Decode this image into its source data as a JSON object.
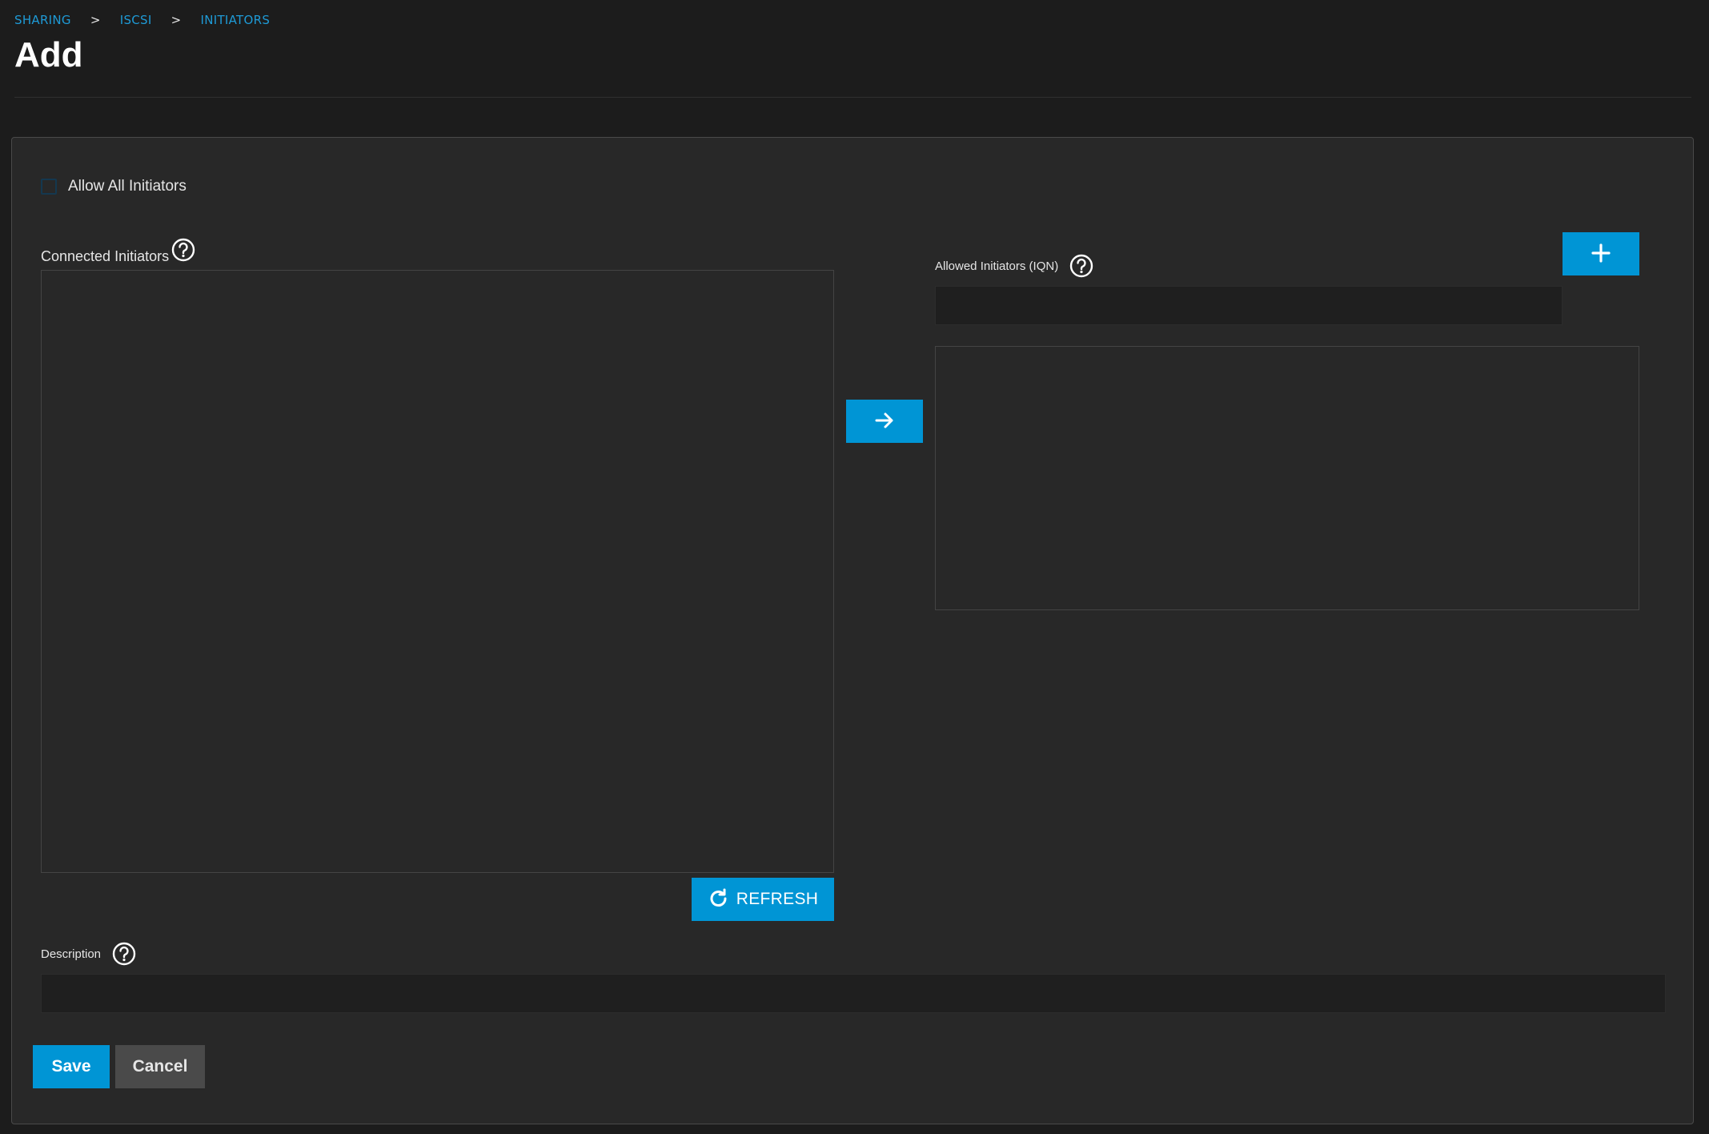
{
  "breadcrumb": {
    "items": [
      "SHARING",
      "ISCSI",
      "INITIATORS"
    ],
    "separator": ">"
  },
  "page": {
    "title": "Add"
  },
  "form": {
    "allow_all": {
      "label": "Allow All Initiators",
      "checked": false
    },
    "connected_initiators": {
      "label": "Connected Initiators",
      "items": []
    },
    "allowed_initiators": {
      "label": "Allowed Initiators (IQN)",
      "value": "",
      "items": []
    },
    "refresh_label": "REFRESH",
    "description": {
      "label": "Description",
      "value": ""
    },
    "save_label": "Save",
    "cancel_label": "Cancel"
  },
  "icons": {
    "help": "help-circle-icon",
    "add": "plus-icon",
    "move": "arrow-right-icon",
    "refresh": "refresh-icon"
  },
  "colors": {
    "accent": "#0095d5",
    "link": "#1e9ad6",
    "background": "#1c1c1c",
    "card": "#282828",
    "secondary_button": "#4a4a4a"
  }
}
